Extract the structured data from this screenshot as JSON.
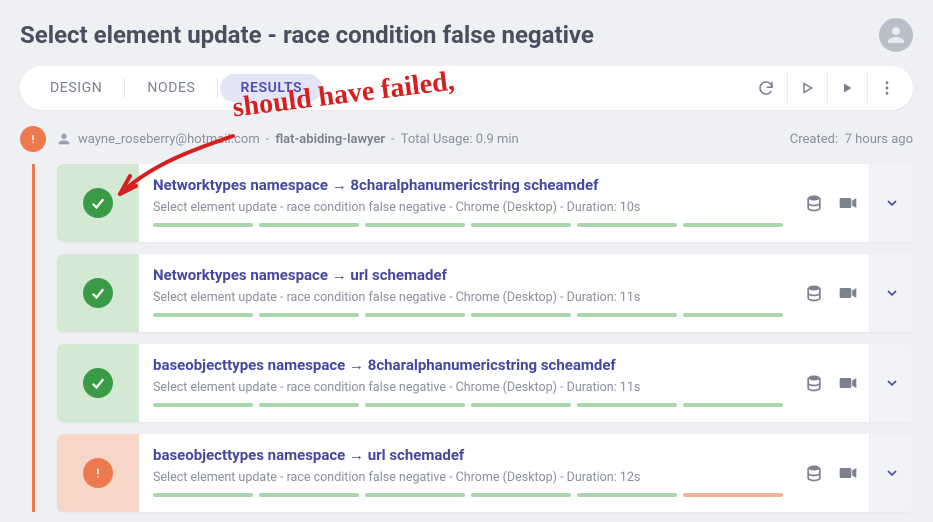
{
  "header": {
    "title": "Select element update - race condition false negative"
  },
  "tabs": {
    "design": "DESIGN",
    "nodes": "NODES",
    "results": "RESULTS"
  },
  "run": {
    "email": "wayne_roseberry@hotmail.com",
    "sep1": " - ",
    "slug": "flat-abiding-lawyer",
    "sep2": " - ",
    "usage": "Total Usage: 0.9 min",
    "created_label": "Created:",
    "created_time": "7 hours ago"
  },
  "rows": [
    {
      "status": "pass",
      "title": "Networktypes namespace → 8charalphanumericstring scheamdef",
      "sub": "Select element update - race condition false negative - Chrome (Desktop) - Duration:  10s",
      "bars": [
        "g",
        "g",
        "g",
        "g",
        "g",
        "g"
      ]
    },
    {
      "status": "pass",
      "title": "Networktypes namespace → url schemadef",
      "sub": "Select element update - race condition false negative - Chrome (Desktop) - Duration:  11s",
      "bars": [
        "g",
        "g",
        "g",
        "g",
        "g",
        "g"
      ]
    },
    {
      "status": "pass",
      "title": "baseobjecttypes namespace → 8charalphanumericstring scheamdef",
      "sub": "Select element update - race condition false negative - Chrome (Desktop) - Duration:  11s",
      "bars": [
        "g",
        "g",
        "g",
        "g",
        "g",
        "g"
      ]
    },
    {
      "status": "fail",
      "title": "baseobjecttypes namespace → url schemadef",
      "sub": "Select element update - race condition false negative - Chrome (Desktop) - Duration:  12s",
      "bars": [
        "g",
        "g",
        "g",
        "g",
        "g",
        "r"
      ]
    }
  ],
  "annotation": {
    "text": "should have failed,"
  }
}
